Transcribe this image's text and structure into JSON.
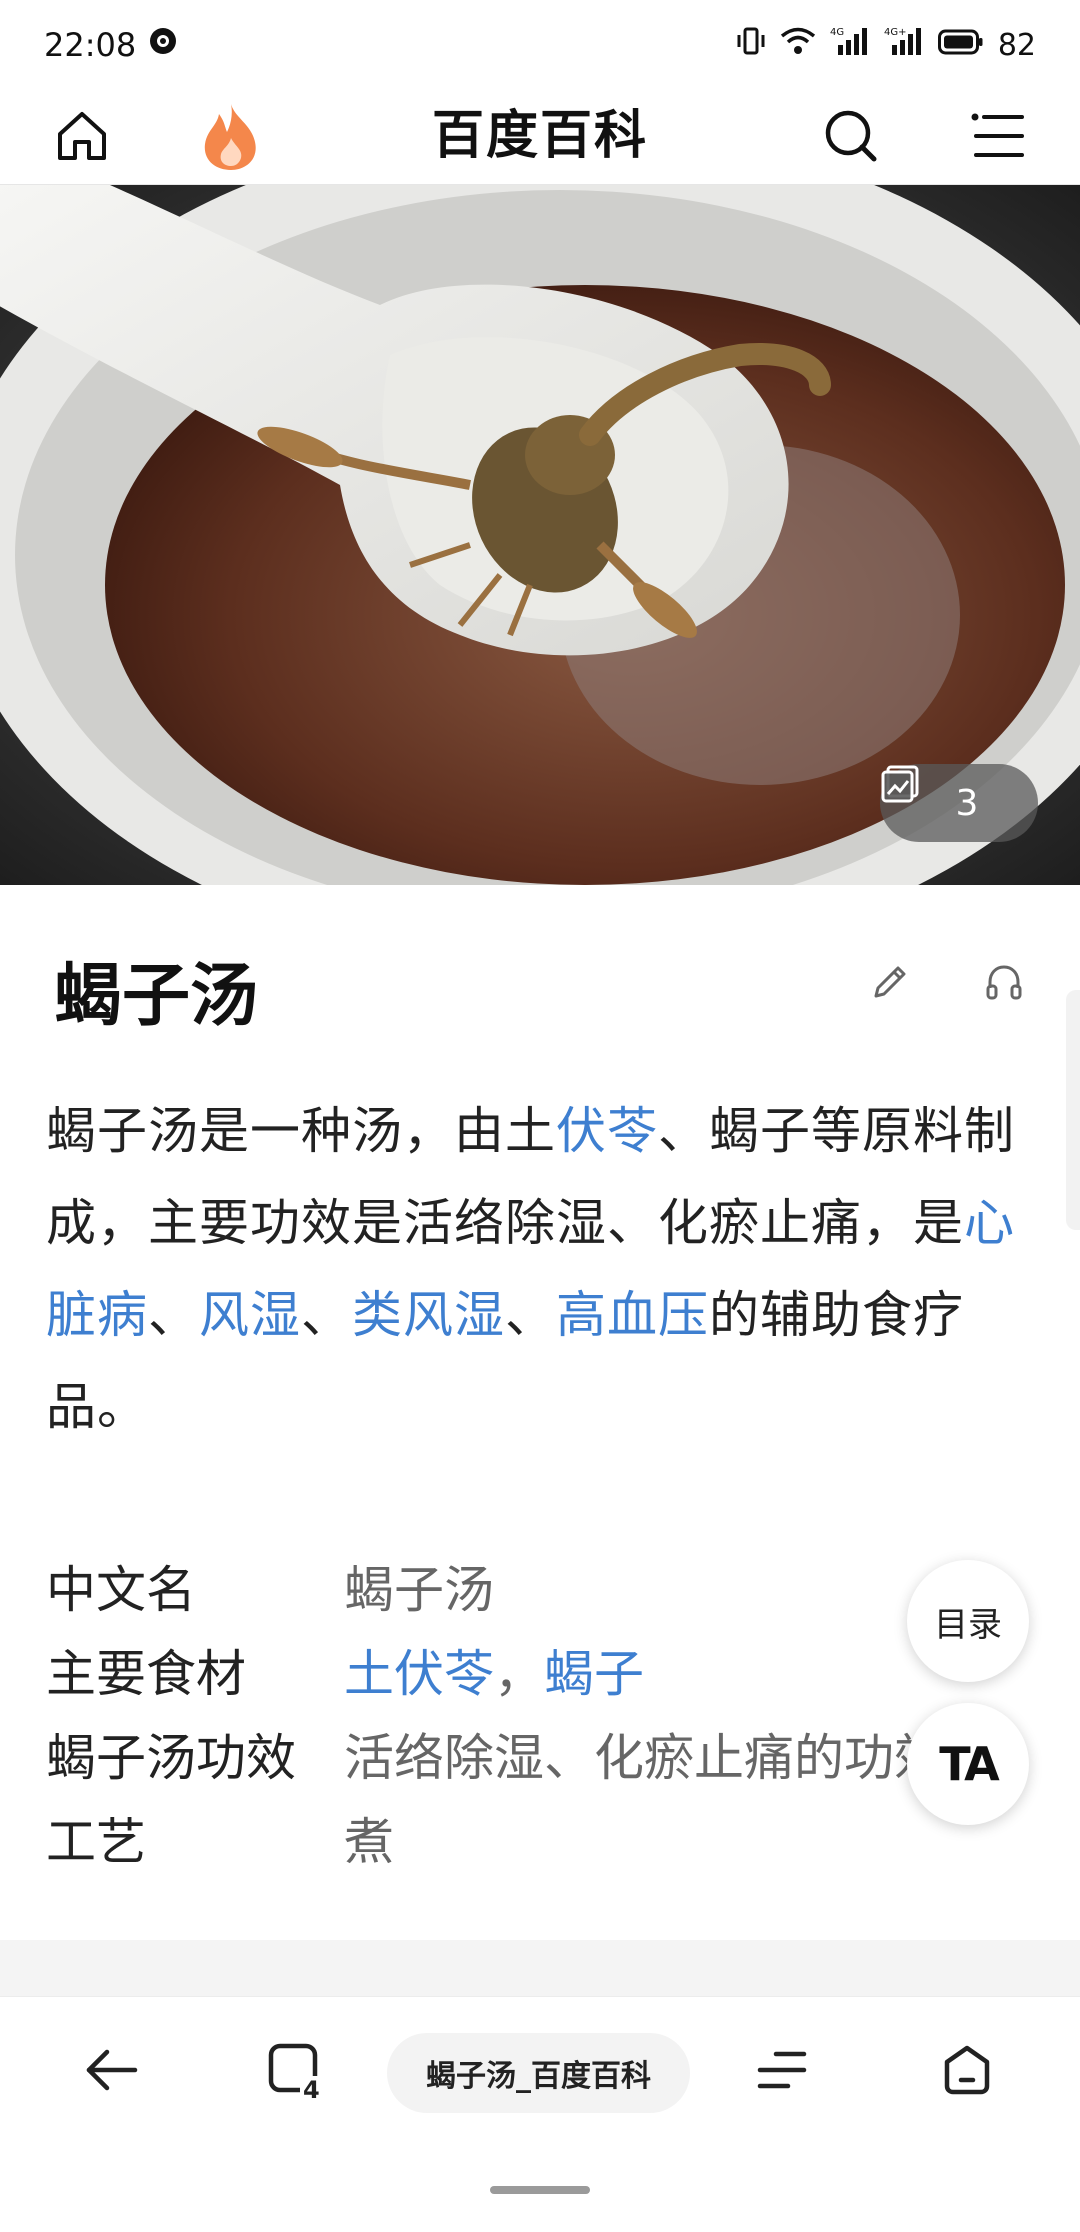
{
  "status_bar": {
    "time": "22:08",
    "battery": "82",
    "network_1": "4G",
    "network_2": "4G+"
  },
  "top_nav": {
    "title": "百度百科"
  },
  "hero": {
    "image_count": "3"
  },
  "article": {
    "title": "蝎子汤",
    "summary": [
      {
        "text": "蝎子汤是一种汤，由土",
        "link": false
      },
      {
        "text": "伏苓",
        "link": true
      },
      {
        "text": "、蝎子等原料制成，主要功效是活络除湿、化瘀止痛，是",
        "link": false
      },
      {
        "text": "心脏病",
        "link": true
      },
      {
        "text": "、",
        "link": false
      },
      {
        "text": "风湿",
        "link": true
      },
      {
        "text": "、",
        "link": false
      },
      {
        "text": "类风湿",
        "link": true
      },
      {
        "text": "、",
        "link": false
      },
      {
        "text": "高血压",
        "link": true
      },
      {
        "text": "的辅助食疗品。",
        "link": false
      }
    ],
    "infobox": {
      "row1_label": "中文名",
      "row1_value": "蝎子汤",
      "row2_label": "主要食材",
      "row2_link1": "土伏苓",
      "row2_sep": "，",
      "row2_link2": "蝎子",
      "row3_label": "蝎子汤功效",
      "row3_value": "活络除湿、化瘀止痛的功效",
      "row4_label": "工艺",
      "row4_value": "煮"
    }
  },
  "floating": {
    "toc_label": "目录",
    "ta_label": "TA"
  },
  "bottom_bar": {
    "url_title": "蝎子汤_百度百科",
    "tab_count": "4"
  },
  "colors": {
    "link": "#3e7fd0",
    "flame": "#f4874b"
  },
  "icons": {
    "home": "home-icon",
    "hot": "flame-icon",
    "search": "search-icon",
    "menu": "menu-icon",
    "gallery": "gallery-icon",
    "edit": "pencil-icon",
    "listen": "headphones-icon",
    "back": "back-arrow-icon",
    "tabs": "tabs-icon",
    "page_menu": "page-menu-icon",
    "browser_home": "browser-home-icon"
  }
}
